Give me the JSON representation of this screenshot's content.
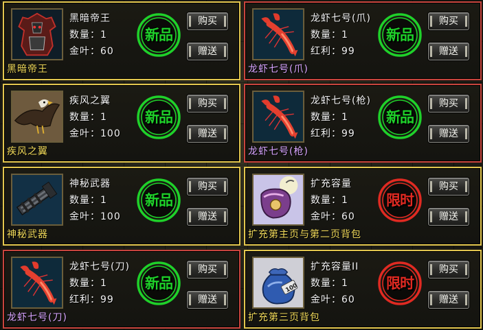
{
  "colors": {
    "border_gold": "#e3c74f",
    "border_red": "#c9453e",
    "caption_gold": "#f0d95a",
    "caption_purple": "#d9a6ff",
    "stamp_green": "#1fd12a",
    "stamp_red": "#e02a22"
  },
  "buttons": {
    "buy": "购买",
    "gift": "赠送"
  },
  "stamps": {
    "new": "新品",
    "limited": "限时"
  },
  "items": [
    {
      "name": "黑暗帝王",
      "qty": "数量：1",
      "price": "金叶：60",
      "caption": "黑暗帝王",
      "caption_color": "#f0d95a",
      "border": "gold",
      "stamp": "new",
      "icon": "dark-emperor-armor-icon"
    },
    {
      "name": "龙虾七号(爪)",
      "qty": "数量：1",
      "price": "红利：99",
      "caption": "龙虾七号(爪)",
      "caption_color": "#d9a6ff",
      "border": "red",
      "stamp": "new",
      "icon": "lobster-icon"
    },
    {
      "name": "疾风之翼",
      "qty": "数量：1",
      "price": "金叶：100",
      "caption": "疾风之翼",
      "caption_color": "#f0d95a",
      "border": "gold",
      "stamp": "new",
      "icon": "eagle-wing-icon"
    },
    {
      "name": "龙虾七号(枪)",
      "qty": "数量：1",
      "price": "红利：99",
      "caption": "龙虾七号(枪)",
      "caption_color": "#d9a6ff",
      "border": "red",
      "stamp": "new",
      "icon": "lobster-icon"
    },
    {
      "name": "神秘武器",
      "qty": "数量：1",
      "price": "金叶：100",
      "caption": "神秘武器",
      "caption_color": "#f0d95a",
      "border": "gold",
      "stamp": "new",
      "icon": "gatling-gun-icon"
    },
    {
      "name": "扩充容量",
      "qty": "数量：1",
      "price": "金叶：60",
      "caption": "扩充第主页与第二页背包",
      "caption_color": "#f0d95a",
      "border": "gold",
      "stamp": "limited",
      "icon": "bag-expansion-icon"
    },
    {
      "name": "龙虾七号(刀)",
      "qty": "数量：1",
      "price": "红利：99",
      "caption": "龙虾七号(刀)",
      "caption_color": "#d9a6ff",
      "border": "red",
      "stamp": "new",
      "icon": "lobster-icon"
    },
    {
      "name": "扩充容量II",
      "qty": "数量：1",
      "price": "金叶：60",
      "caption": "扩充第三页背包",
      "caption_color": "#f0d95a",
      "border": "gold",
      "stamp": "limited",
      "icon": "money-bag-icon"
    }
  ]
}
